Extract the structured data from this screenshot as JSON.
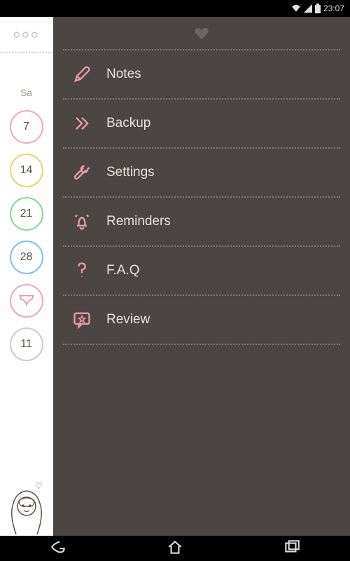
{
  "statusbar": {
    "time": "23:07"
  },
  "sidebar": {
    "day_label": "Sa",
    "dates": [
      {
        "value": "7",
        "color": "pink"
      },
      {
        "value": "14",
        "color": "yellow"
      },
      {
        "value": "21",
        "color": "green"
      },
      {
        "value": "28",
        "color": "blue"
      },
      {
        "value": "",
        "color": "pink",
        "icon": "underwear"
      },
      {
        "value": "11",
        "color": "gray"
      }
    ]
  },
  "menu": {
    "items": [
      {
        "icon": "pencil",
        "label": "Notes"
      },
      {
        "icon": "chevrons",
        "label": "Backup"
      },
      {
        "icon": "wrench",
        "label": "Settings"
      },
      {
        "icon": "bell",
        "label": "Reminders"
      },
      {
        "icon": "question",
        "label": "F.A.Q"
      },
      {
        "icon": "star-chat",
        "label": "Review"
      }
    ]
  }
}
